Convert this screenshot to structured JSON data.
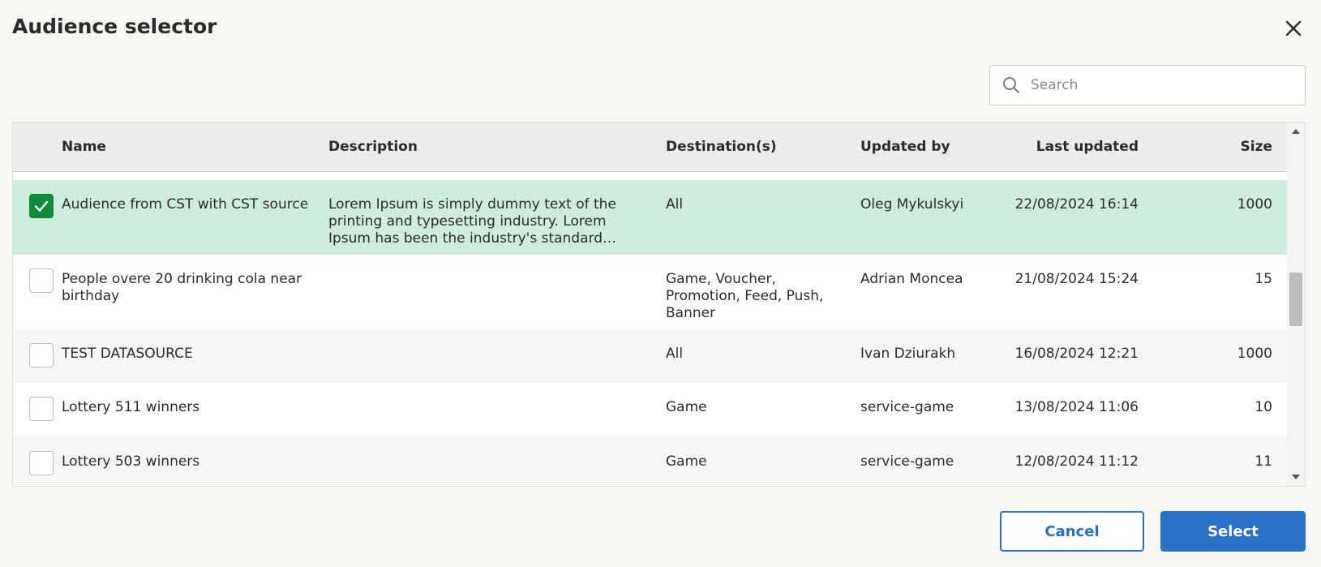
{
  "dialog": {
    "title": "Audience selector",
    "close_icon": "close-icon"
  },
  "search": {
    "placeholder": "Search",
    "value": "",
    "icon": "search-icon"
  },
  "table": {
    "columns": {
      "name": "Name",
      "description": "Description",
      "destinations": "Destination(s)",
      "updated_by": "Updated by",
      "last_updated": "Last updated",
      "size": "Size"
    },
    "rows": [
      {
        "checked": true,
        "name": "Audience from CST with CST source",
        "description": "Lorem Ipsum is simply dummy text of the printing and typesetting industry. Lorem Ipsum has been the industry's standard…",
        "destinations": "All",
        "updated_by": "Oleg Mykulskyi",
        "last_updated": "22/08/2024 16:14",
        "size": "1000"
      },
      {
        "checked": false,
        "name": "People overe 20 drinking cola near birthday",
        "description": "",
        "destinations": "Game, Voucher, Promotion, Feed, Push, Banner",
        "updated_by": "Adrian Moncea",
        "last_updated": "21/08/2024 15:24",
        "size": "15"
      },
      {
        "checked": false,
        "name": "TEST DATASOURCE",
        "description": "",
        "destinations": "All",
        "updated_by": "Ivan Dziurakh",
        "last_updated": "16/08/2024 12:21",
        "size": "1000"
      },
      {
        "checked": false,
        "name": "Lottery 511 winners",
        "description": "",
        "destinations": "Game",
        "updated_by": "service-game",
        "last_updated": "13/08/2024 11:06",
        "size": "10"
      },
      {
        "checked": false,
        "name": "Lottery 503 winners",
        "description": "",
        "destinations": "Game",
        "updated_by": "service-game",
        "last_updated": "12/08/2024 11:12",
        "size": "11"
      }
    ]
  },
  "footer": {
    "cancel_label": "Cancel",
    "select_label": "Select"
  },
  "colors": {
    "selected_row": "#cdeedd",
    "checkbox_checked": "#118a3a",
    "primary": "#2a72c8",
    "header_bg": "#ececec"
  }
}
